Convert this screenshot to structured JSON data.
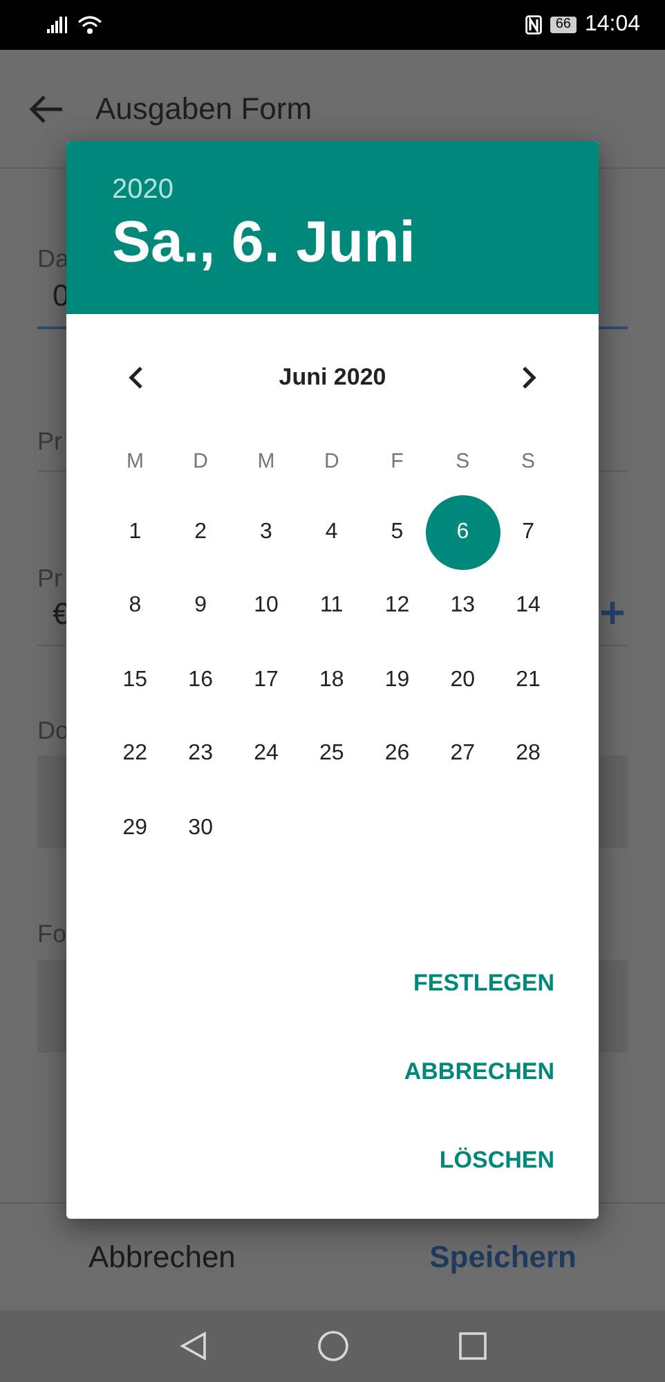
{
  "status_bar": {
    "battery": "66",
    "time": "14:04"
  },
  "app_bar": {
    "title": "Ausgaben Form"
  },
  "form": {
    "fields": [
      {
        "kind": "text",
        "label": "Da",
        "value": "0",
        "focused": true
      },
      {
        "kind": "text",
        "label": "Pr",
        "focused": false
      },
      {
        "kind": "amount",
        "label": "Pr",
        "value": "€",
        "focused": false
      },
      {
        "kind": "area",
        "label": "Do"
      },
      {
        "kind": "area",
        "label": "Fo"
      }
    ]
  },
  "bottom_actions": [
    {
      "label": "Abbrechen",
      "primary": false
    },
    {
      "label": "Speichern",
      "primary": true
    }
  ],
  "dialog": {
    "year": "2020",
    "date_heading": "Sa., 6. Juni",
    "month_label": "Juni 2020",
    "weekdays": [
      "M",
      "D",
      "M",
      "D",
      "F",
      "S",
      "S"
    ],
    "days": [
      {
        "label": "1",
        "selected": false
      },
      {
        "label": "2",
        "selected": false
      },
      {
        "label": "3",
        "selected": false
      },
      {
        "label": "4",
        "selected": false
      },
      {
        "label": "5",
        "selected": false
      },
      {
        "label": "6",
        "selected": true
      },
      {
        "label": "7",
        "selected": false
      },
      {
        "label": "8",
        "selected": false
      },
      {
        "label": "9",
        "selected": false
      },
      {
        "label": "10",
        "selected": false
      },
      {
        "label": "11",
        "selected": false
      },
      {
        "label": "12",
        "selected": false
      },
      {
        "label": "13",
        "selected": false
      },
      {
        "label": "14",
        "selected": false
      },
      {
        "label": "15",
        "selected": false
      },
      {
        "label": "16",
        "selected": false
      },
      {
        "label": "17",
        "selected": false
      },
      {
        "label": "18",
        "selected": false
      },
      {
        "label": "19",
        "selected": false
      },
      {
        "label": "20",
        "selected": false
      },
      {
        "label": "21",
        "selected": false
      },
      {
        "label": "22",
        "selected": false
      },
      {
        "label": "23",
        "selected": false
      },
      {
        "label": "24",
        "selected": false
      },
      {
        "label": "25",
        "selected": false
      },
      {
        "label": "26",
        "selected": false
      },
      {
        "label": "27",
        "selected": false
      },
      {
        "label": "28",
        "selected": false
      },
      {
        "label": "29",
        "selected": false
      },
      {
        "label": "30",
        "selected": false
      }
    ],
    "actions": [
      "FESTLEGEN",
      "ABBRECHEN",
      "LÖSCHEN"
    ]
  }
}
